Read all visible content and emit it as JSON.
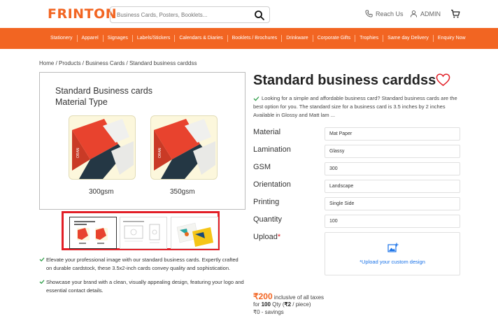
{
  "header": {
    "logo_text": "FRINTON",
    "search_placeholder": "Business Cards, Posters, Booklets...",
    "reach_us": "Reach Us",
    "admin": "ADMIN"
  },
  "nav": {
    "items": [
      "Stationery",
      "Apparel",
      "Signages",
      "Labels/Stickers",
      "Calendars & Diaries",
      "Booklets / Brochures",
      "Drinkware",
      "Corporate Gifts",
      "Trophies",
      "Same day Delivery",
      "Enquiry Now"
    ]
  },
  "breadcrumb": "Home / Products / Business Cards / Standard business carddss",
  "main_image": {
    "title": "Standard Business cards\nMaterial Type",
    "left_label": "300gsm",
    "right_label": "350gsm",
    "card_brand": "ORAN"
  },
  "bullets": [
    "Elevate your professional image with our standard business cards. Expertly crafted on durable cardstock, these 3.5x2-inch cards convey quality and sophistication.",
    "Showcase your brand with a clean, visually appealing design, featuring your logo and essential contact details."
  ],
  "product": {
    "title": "Standard business carddss",
    "description": "Looking for a simple and affordable business card? Standard business cards are the best option for you. The standard size for a business card is 3.5 inches by 2 inches Available in Glossy and Matt lam ...",
    "options": [
      {
        "label": "Material",
        "value": "Mat Paper"
      },
      {
        "label": "Lamination",
        "value": "Glassy"
      },
      {
        "label": "GSM",
        "value": "300"
      },
      {
        "label": "Orientation",
        "value": "Landscape"
      },
      {
        "label": "Printing",
        "value": "Single Side"
      },
      {
        "label": "Quantity",
        "value": "100"
      }
    ],
    "upload_label": "Upload",
    "upload_required": "*",
    "upload_text": "*Upload your custom design",
    "price_amount": "₹200",
    "price_suffix": " inclusive of all taxes",
    "qty_prefix": "for ",
    "qty_value": "100",
    "qty_mid": " Qty (",
    "per_piece": "₹2",
    "qty_suffix": " / piece)",
    "savings": "₹0 - savings"
  },
  "colors": {
    "brand": "#f26522",
    "highlight": "#e21e26",
    "link": "#1a73e8",
    "check": "#2e9e48"
  }
}
